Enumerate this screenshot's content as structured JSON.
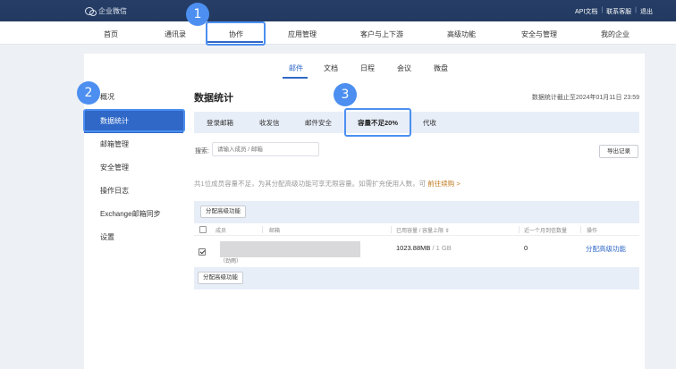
{
  "topbar": {
    "brand": "企业微信",
    "links": [
      "API文档",
      "联系客服",
      "退出"
    ]
  },
  "nav": {
    "items": [
      "首页",
      "通讯录",
      "协作",
      "应用管理",
      "客户与上下游",
      "高级功能",
      "安全与管理",
      "我的企业"
    ],
    "active": "协作"
  },
  "subtabs": {
    "items": [
      "邮件",
      "文档",
      "日程",
      "会议",
      "微盘"
    ],
    "active": "邮件"
  },
  "sidebar": {
    "items": [
      "概况",
      "数据统计",
      "邮箱管理",
      "安全管理",
      "操作日志",
      "Exchange邮箱同步",
      "设置"
    ],
    "active": "数据统计"
  },
  "main": {
    "title": "数据统计",
    "update_time": "数据统计截止至2024年01月11日 23:59",
    "tabs": [
      "登录邮箱",
      "收发信",
      "邮件安全",
      "容量不足20%",
      "代收"
    ],
    "active_tab": "容量不足20%",
    "search_label": "搜索:",
    "search_placeholder": "请输入成员 / 邮箱",
    "export_label": "导出记录",
    "notice_text": "共1位成员容量不足，为其分配高级功能可享无限容量。如需扩充使用人数，可",
    "notice_link": "前往续购 >",
    "alloc_button": "分配高级功能"
  },
  "table": {
    "headers": [
      "成员",
      "邮箱",
      "已用容量 / 容量上限 ⇕",
      "近一个月到信数量",
      "操作"
    ],
    "rows": [
      {
        "checked": true,
        "sub": "（劲雨）",
        "used": "1023.88MB",
        "limit": " / 1 GB",
        "count": "0",
        "action": "分配高级功能"
      }
    ]
  },
  "callouts": [
    "1",
    "2",
    "3"
  ]
}
